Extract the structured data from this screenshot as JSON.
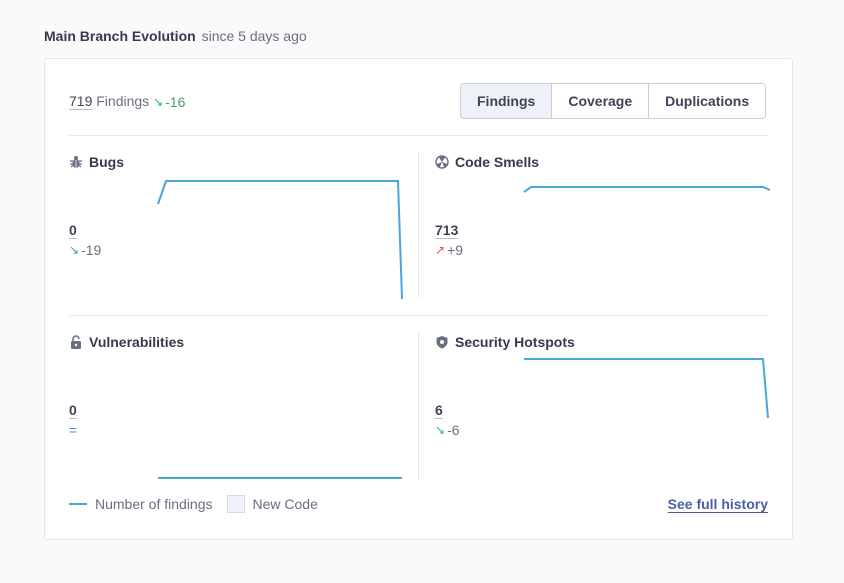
{
  "heading": {
    "title": "Main Branch Evolution",
    "since": "since 5 days ago"
  },
  "summary": {
    "count": "719",
    "label": "Findings",
    "delta": "-16"
  },
  "tabs": [
    {
      "label": "Findings",
      "active": true
    },
    {
      "label": "Coverage",
      "active": false
    },
    {
      "label": "Duplications",
      "active": false
    }
  ],
  "panels": {
    "bugs": {
      "title": "Bugs",
      "value": "0",
      "delta": "-19",
      "trend": "down",
      "icon": "bug-icon"
    },
    "code_smells": {
      "title": "Code Smells",
      "value": "713",
      "delta": "+9",
      "trend": "up",
      "icon": "code-smell-icon"
    },
    "vulnerabilities": {
      "title": "Vulnerabilities",
      "value": "0",
      "delta": "=",
      "trend": "equal",
      "icon": "lock-icon"
    },
    "hotspots": {
      "title": "Security Hotspots",
      "value": "6",
      "delta": "-6",
      "trend": "down",
      "icon": "shield-icon"
    }
  },
  "legend": {
    "findings": "Number of findings",
    "new_code": "New Code"
  },
  "history_link": "See full history",
  "colors": {
    "line": "#4aa6d6",
    "good": "#2fb36d",
    "bad": "#e55040"
  }
}
